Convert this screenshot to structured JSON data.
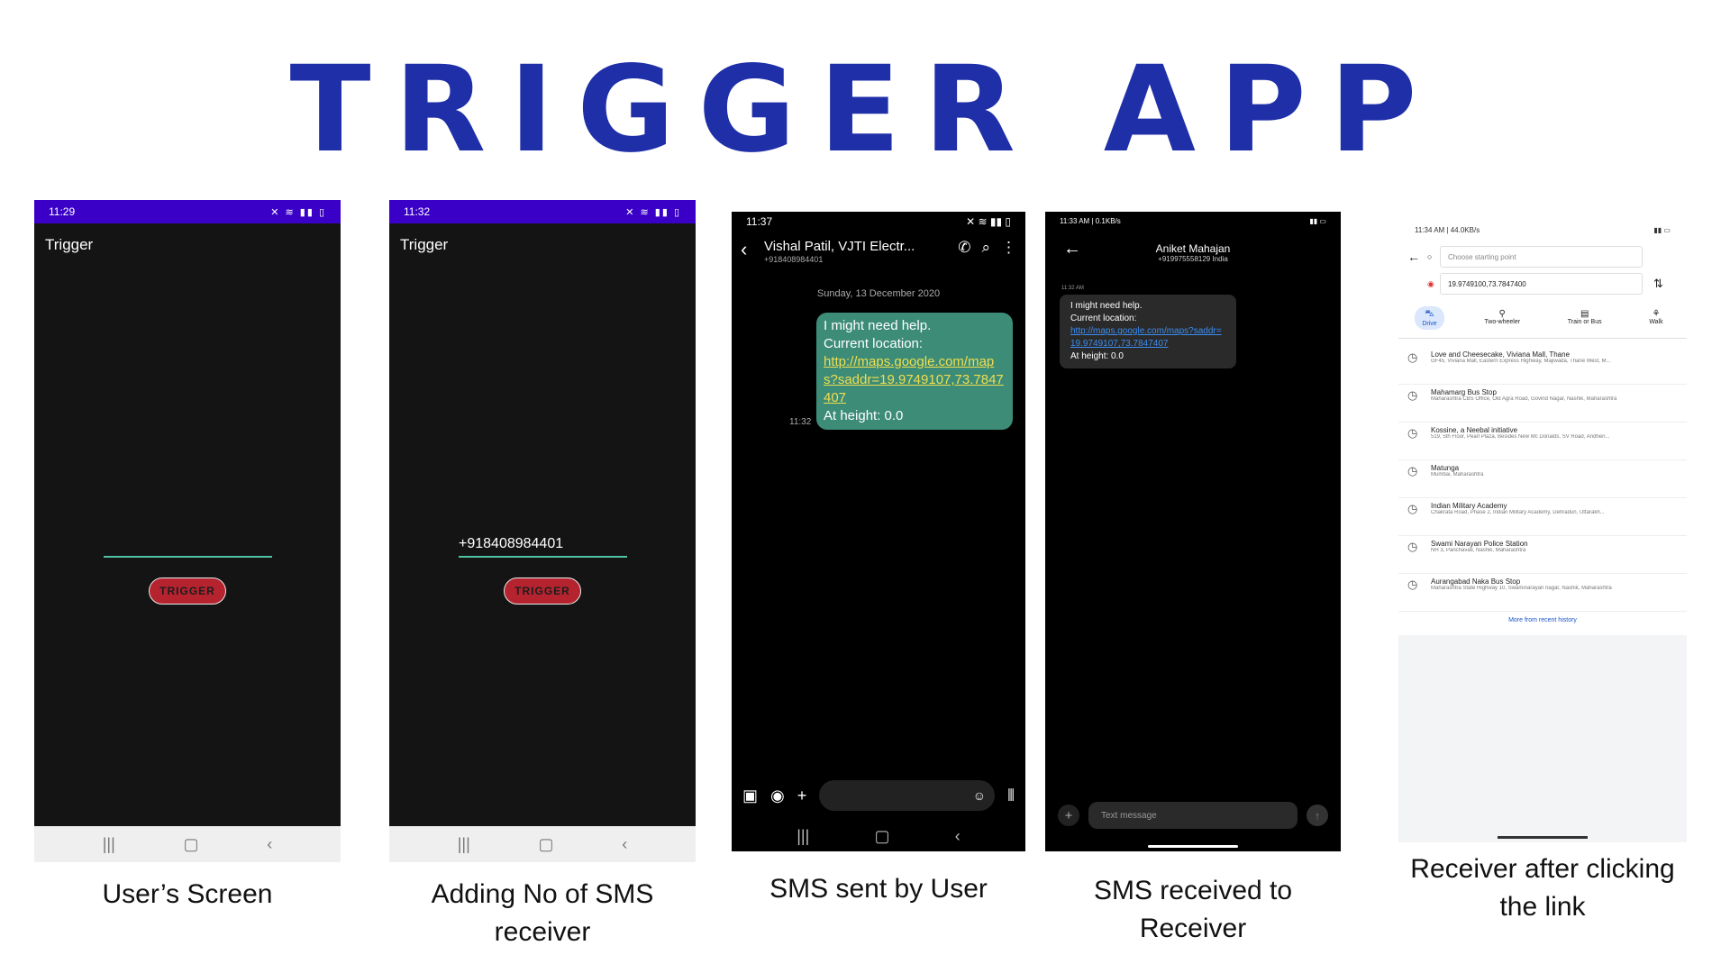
{
  "title": "TRIGGER APP",
  "phone1": {
    "time": "11:29",
    "status_icons": "🔇 📶 🔋",
    "app_title": "Trigger",
    "phone_number": "",
    "trigger_label": "TRIGGER",
    "caption": "User’s Screen"
  },
  "phone2": {
    "time": "11:32",
    "status_icons": "🔇 📶 🔋",
    "app_title": "Trigger",
    "phone_number": "+918408984401",
    "trigger_label": "TRIGGER",
    "caption": "Adding No of SMS receiver"
  },
  "phone3": {
    "time": "11:37",
    "contact_name": "Vishal Patil, VJTI Electr...",
    "contact_number": "+918408984401",
    "date": "Sunday, 13 December 2020",
    "msg_line1": "I might need help.",
    "msg_line2": "Current location:",
    "msg_link": "http://maps.google.com/maps?saddr=19.9749107,73.7847407",
    "msg_line3": "At height: 0.0",
    "msg_time": "11:32",
    "caption": "SMS sent by User"
  },
  "phone4": {
    "status_left": "11:33 AM | 0.1KB/s",
    "contact_name": "Aniket Mahajan",
    "contact_number": "+919975558129 India",
    "msg_time": "11:32 AM",
    "msg_line1": "I might need help.",
    "msg_line2": "Current location:",
    "msg_link": "http://maps.google.com/maps?saddr=19.9749107,73.7847407",
    "msg_line3": "At height: 0.0",
    "input_placeholder": "Text message",
    "caption": "SMS received to Receiver"
  },
  "phone5": {
    "status_left": "11:34 AM | 44.0KB/s",
    "start_placeholder": "Choose starting point",
    "destination": "19.9749100,73.7847400",
    "modes": [
      "Drive",
      "Two-wheeler",
      "Train or Bus",
      "Walk"
    ],
    "places": [
      {
        "name": "Love and Cheesecake, Viviana Mall, Thane",
        "addr": "GF45, Viviana Mall, Eastern Express Highway, Majiwada, Thane West, M..."
      },
      {
        "name": "Mahamarg Bus Stop",
        "addr": "Maharashtra CBS Office, Old Agra Road, Govind Nagar, Nashik, Maharashtra"
      },
      {
        "name": "Kossine, a Neebal initiative",
        "addr": "519, 5th Floor, Pearl Plaza, Besides New Mc Donalds, SV Road, Andheri..."
      },
      {
        "name": "Matunga",
        "addr": "Mumbai, Maharashtra"
      },
      {
        "name": "Indian Military Academy",
        "addr": "Chakrata Road, Phase 2, Indian Military Academy, Dehradun, Uttarakh..."
      },
      {
        "name": "Swami Narayan Police Station",
        "addr": "NH 3, Panchavati, Nashik, Maharashtra"
      },
      {
        "name": "Aurangabad Naka Bus Stop",
        "addr": "Maharashtra State Highway 10, Swaminarayan nagar, Nashik, Maharashtra"
      }
    ],
    "more_link": "More from recent history",
    "caption": "Receiver after clicking the link"
  }
}
